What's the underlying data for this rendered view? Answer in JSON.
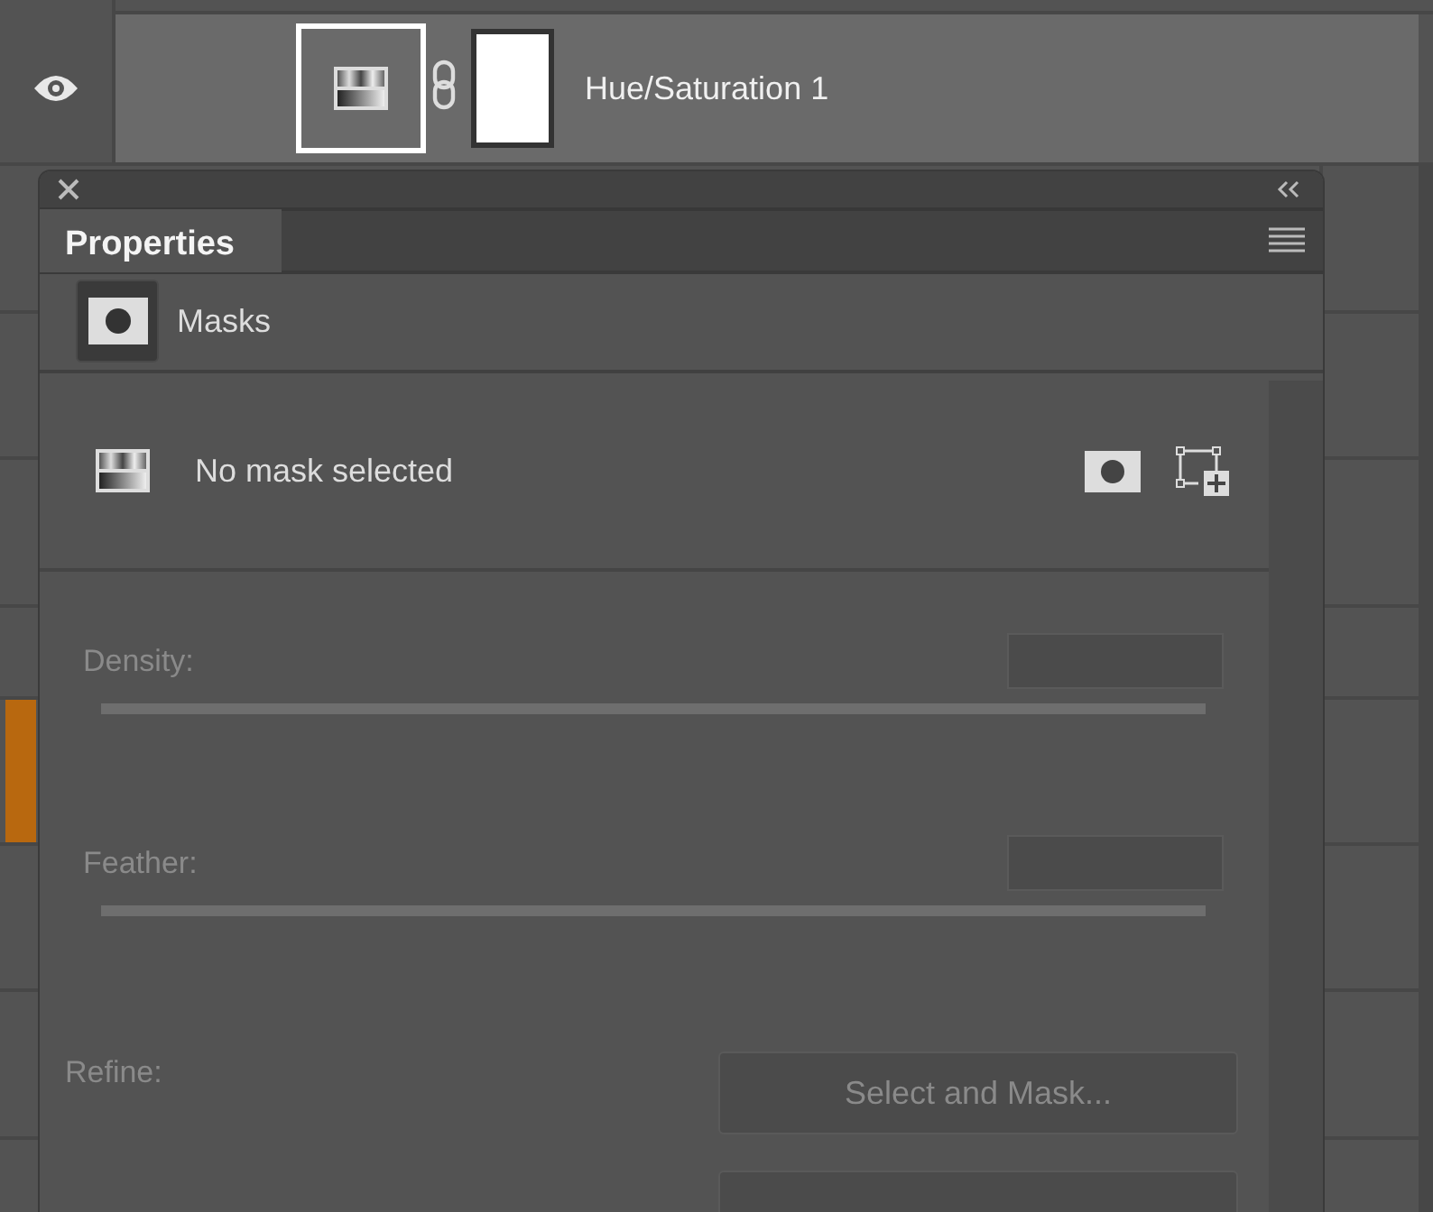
{
  "layer": {
    "visible": true,
    "selected": true,
    "linked": true,
    "name": "Hue/Saturation 1"
  },
  "color_label": {
    "color": "#b8680f"
  },
  "properties": {
    "title": "Properties",
    "section": "Masks",
    "mask_status": "No mask selected",
    "controls": [
      {
        "kind": "slider",
        "label": "Density:",
        "disabled": true
      },
      {
        "kind": "slider",
        "label": "Feather:",
        "disabled": true
      },
      {
        "kind": "buttons",
        "label": "Refine:",
        "buttons": [
          {
            "label": "Select and Mask...",
            "disabled": true
          },
          {
            "disabled": true
          }
        ]
      }
    ]
  }
}
